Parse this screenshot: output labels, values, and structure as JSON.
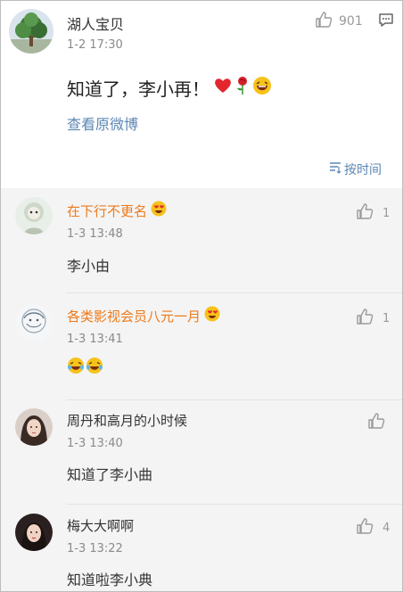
{
  "post": {
    "author": "湖人宝贝",
    "time": "1-2 17:30",
    "like_count": "901",
    "text": "知道了，李小再！",
    "link": "查看原微博",
    "sort_label": "按时间"
  },
  "replies": [
    {
      "name": "在下行不更名",
      "time": "1-3 13:48",
      "text": "李小由",
      "likes": "1"
    },
    {
      "name": "各类影视会员八元一月",
      "time": "1-3 13:41",
      "text": "",
      "likes": "1"
    },
    {
      "name": "周丹和高月的小时候",
      "time": "1-3 13:40",
      "text": "知道了李小曲",
      "likes": ""
    },
    {
      "name": "梅大大啊啊",
      "time": "1-3 13:22",
      "text": "知道啦李小典",
      "likes": "4"
    }
  ],
  "colors": {
    "link": "#5d87b4",
    "vip_name": "#ee7a1a",
    "reply_bg": "#f4f4f4"
  }
}
